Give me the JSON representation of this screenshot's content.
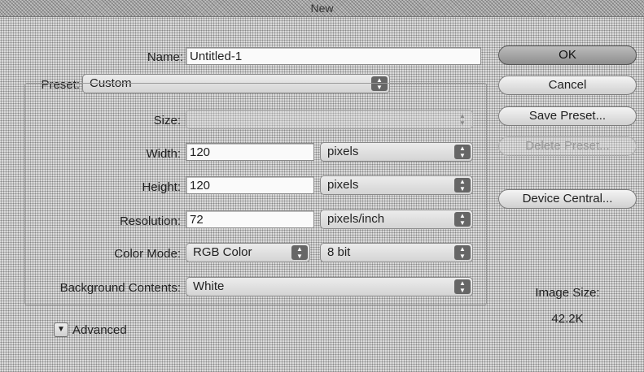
{
  "window": {
    "title": "New"
  },
  "form": {
    "name_label": "Name:",
    "name_value": "Untitled-1",
    "preset_label": "Preset:",
    "preset_value": "Custom",
    "size_label": "Size:",
    "size_value": "",
    "width_label": "Width:",
    "width_value": "120",
    "width_unit": "pixels",
    "height_label": "Height:",
    "height_value": "120",
    "height_unit": "pixels",
    "resolution_label": "Resolution:",
    "resolution_value": "72",
    "resolution_unit": "pixels/inch",
    "color_mode_label": "Color Mode:",
    "color_mode_value": "RGB Color",
    "bit_depth_value": "8 bit",
    "background_label": "Background Contents:",
    "background_value": "White",
    "advanced_label": "Advanced"
  },
  "buttons": {
    "ok": "OK",
    "cancel": "Cancel",
    "save_preset": "Save Preset...",
    "delete_preset": "Delete Preset...",
    "device_central": "Device Central..."
  },
  "info": {
    "image_size_label": "Image Size:",
    "image_size_value": "42.2K"
  }
}
